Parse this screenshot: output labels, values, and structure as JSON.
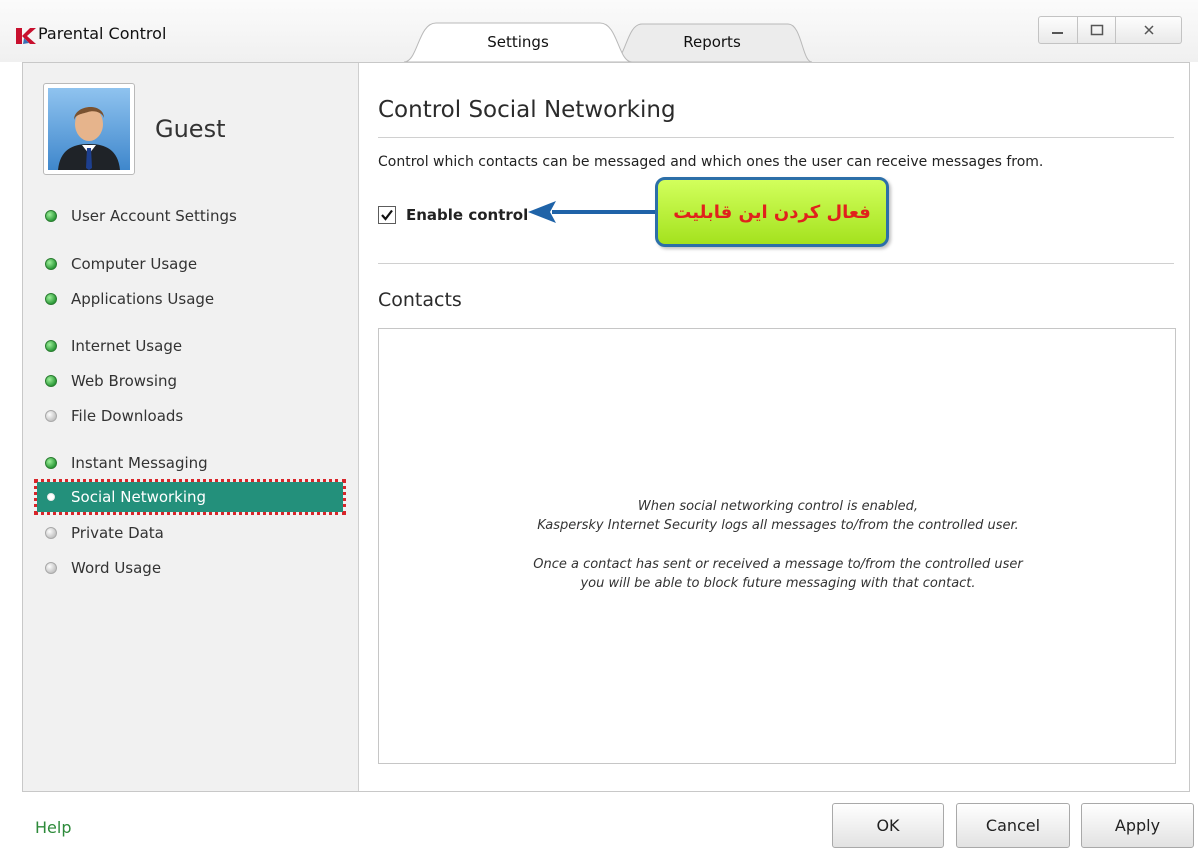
{
  "window": {
    "title": "Parental Control",
    "tabs": [
      {
        "label": "Settings",
        "active": true
      },
      {
        "label": "Reports",
        "active": false
      }
    ]
  },
  "user": {
    "name": "Guest"
  },
  "sidebar": {
    "items": [
      {
        "label": "User Account Settings",
        "status": "green"
      },
      {
        "label": "Computer Usage",
        "status": "green"
      },
      {
        "label": "Applications Usage",
        "status": "green"
      },
      {
        "label": "Internet Usage",
        "status": "green"
      },
      {
        "label": "Web Browsing",
        "status": "green"
      },
      {
        "label": "File Downloads",
        "status": "gray"
      },
      {
        "label": "Instant Messaging",
        "status": "green"
      },
      {
        "label": "Social Networking",
        "status": "selected"
      },
      {
        "label": "Private Data",
        "status": "gray"
      },
      {
        "label": "Word Usage",
        "status": "gray"
      }
    ]
  },
  "main": {
    "title": "Control Social Networking",
    "description": "Control which contacts can be messaged and which ones the user can receive messages from.",
    "enable_control": {
      "label": "Enable control",
      "checked": true
    },
    "callout_text": "فعال کردن این قابلیت",
    "contacts": {
      "title": "Contacts",
      "info_lines": [
        "When social networking control is enabled,",
        "Kaspersky Internet Security logs all messages to/from the controlled user.",
        "Once a contact has sent or received a message to/from the controlled user",
        "you will be able to block future messaging with that contact."
      ]
    }
  },
  "footer": {
    "help": "Help",
    "ok": "OK",
    "cancel": "Cancel",
    "apply": "Apply"
  },
  "colors": {
    "selected_bg": "#23907b",
    "highlight_outline": "#d8262a",
    "callout_bg": "#b8ef3a",
    "callout_border": "#2c6fa8",
    "callout_text": "#e0221c",
    "help_link": "#2d8a3a"
  }
}
